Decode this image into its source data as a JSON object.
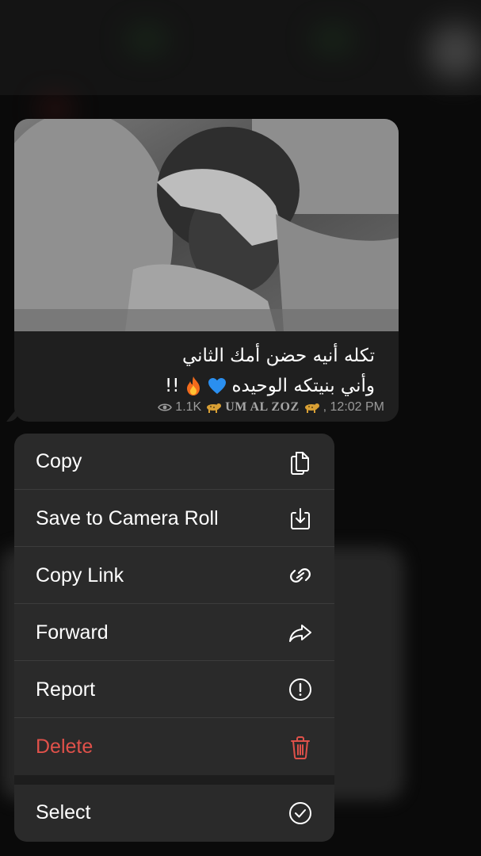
{
  "message": {
    "caption_line1": "تكله أنيه حضن أمك الثاني",
    "caption_line2": "وأني بنيتكه الوحيده",
    "caption_suffix": "!!",
    "views": "1.1K",
    "channel": "UM AL ZOZ",
    "time": ", 12:02 PM"
  },
  "menu": {
    "items": [
      {
        "label": "Copy",
        "icon": "copy-icon"
      },
      {
        "label": "Save to Camera Roll",
        "icon": "download-icon"
      },
      {
        "label": "Copy Link",
        "icon": "link-icon"
      },
      {
        "label": "Forward",
        "icon": "forward-icon"
      },
      {
        "label": "Report",
        "icon": "report-icon"
      },
      {
        "label": "Delete",
        "icon": "trash-icon"
      },
      {
        "label": "Select",
        "icon": "check-circle-icon"
      }
    ]
  },
  "colors": {
    "menu_bg": "#2a2a2a",
    "delete": "#e0514a",
    "bubble_bg": "#1f1f1f"
  }
}
